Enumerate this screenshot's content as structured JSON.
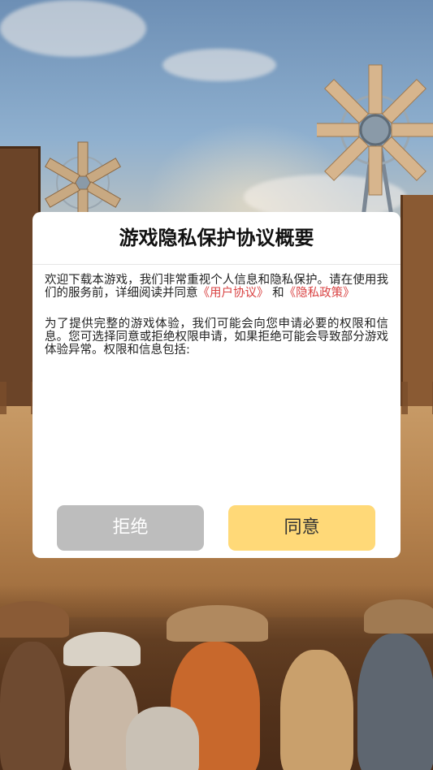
{
  "dialog": {
    "title": "游戏隐私保护协议概要",
    "paragraph1": {
      "text_before": "欢迎下载本游戏，我们非常重视个人信息和隐私保护。请在使用我们的服务前，详细阅读并同意",
      "link_user_agreement": "《用户协议》",
      "text_between": " 和",
      "link_privacy_policy": "《隐私政策》"
    },
    "paragraph2": "为了提供完整的游戏体验，我们可能会向您申请必要的权限和信息。您可选择同意或拒绝权限申请，如果拒绝可能会导致部分游戏体验异常。权限和信息包括:",
    "buttons": {
      "reject_label": "拒绝",
      "agree_label": "同意"
    }
  },
  "colors": {
    "link": "#d94343",
    "agree_button": "#ffd978",
    "reject_button": "#bdbdbd"
  }
}
